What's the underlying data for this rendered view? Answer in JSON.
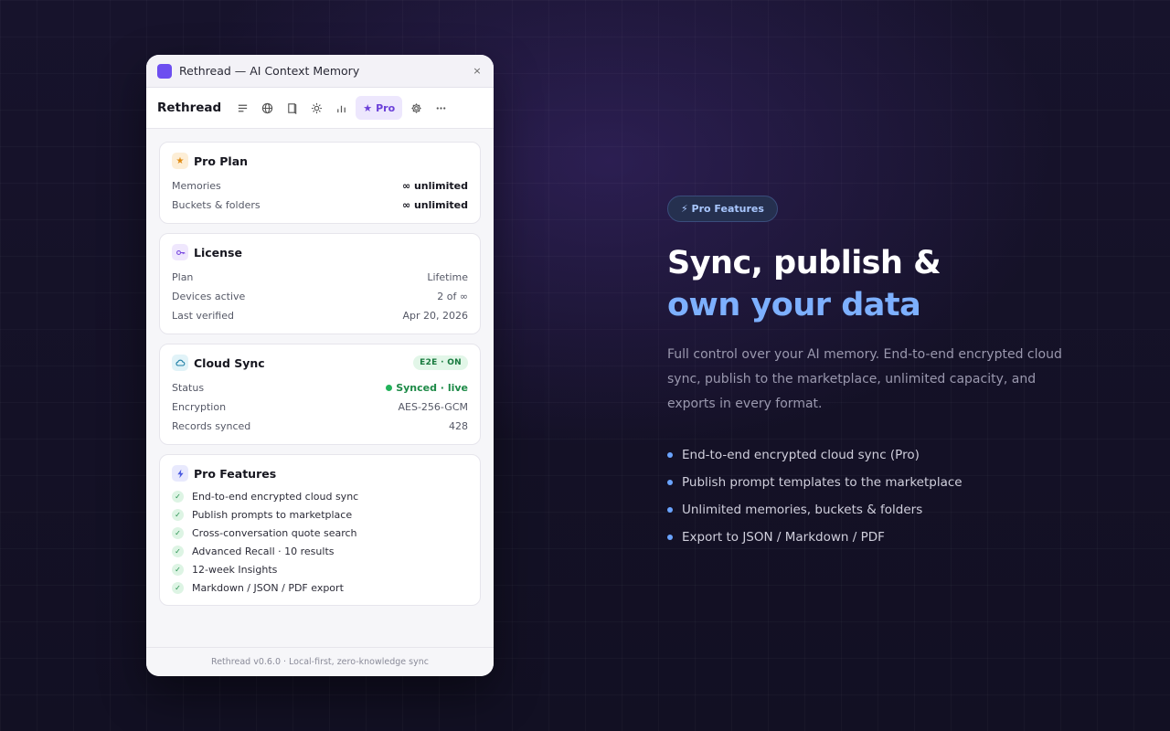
{
  "window": {
    "title": "Rethread — AI Context Memory",
    "close_glyph": "×"
  },
  "toolbar": {
    "brand": "Rethread",
    "pro_star": "★",
    "pro_label": "Pro",
    "more_glyph": "•••"
  },
  "pro_plan": {
    "title": "Pro Plan",
    "icon_glyph": "★",
    "rows": [
      {
        "label": "Memories",
        "value": "∞ unlimited"
      },
      {
        "label": "Buckets & folders",
        "value": "∞ unlimited"
      }
    ]
  },
  "license": {
    "title": "License",
    "rows": [
      {
        "label": "Plan",
        "value": "Lifetime"
      },
      {
        "label": "Devices active",
        "value": "2 of ∞"
      },
      {
        "label": "Last verified",
        "value": "Apr 20, 2026"
      }
    ]
  },
  "cloud_sync": {
    "title": "Cloud Sync",
    "badge": "E2E · ON",
    "status_label": "Status",
    "status_value": "Synced · live",
    "rows": [
      {
        "label": "Encryption",
        "value": "AES-256-GCM"
      },
      {
        "label": "Records synced",
        "value": "428"
      }
    ]
  },
  "pro_features": {
    "title": "Pro Features",
    "check_glyph": "✓",
    "items": [
      "End-to-end encrypted cloud sync",
      "Publish prompts to marketplace",
      "Cross-conversation quote search",
      "Advanced Recall · 10 results",
      "12-week Insights",
      "Markdown / JSON / PDF export"
    ]
  },
  "footer": "Rethread v0.6.0 · Local-first, zero-knowledge sync",
  "marketing": {
    "pill": "⚡ Pro Features",
    "headline_line1": "Sync, publish &",
    "headline_line2": "own your data",
    "description": "Full control over your AI memory. End-to-end encrypted cloud sync, publish to the marketplace, unlimited capacity, and exports in every format.",
    "bullets": [
      "End-to-end encrypted cloud sync (Pro)",
      "Publish prompt templates to the marketplace",
      "Unlimited memories, buckets & folders",
      "Export to JSON / Markdown / PDF"
    ]
  },
  "colors": {
    "accent": "#6d4ef0",
    "link_blue": "#7db0ff",
    "success": "#1d8a47"
  },
  "icons": [
    "list-icon",
    "globe-icon",
    "book-icon",
    "sun-icon",
    "bar-chart-icon",
    "star-icon",
    "gear-icon",
    "more-icon"
  ]
}
